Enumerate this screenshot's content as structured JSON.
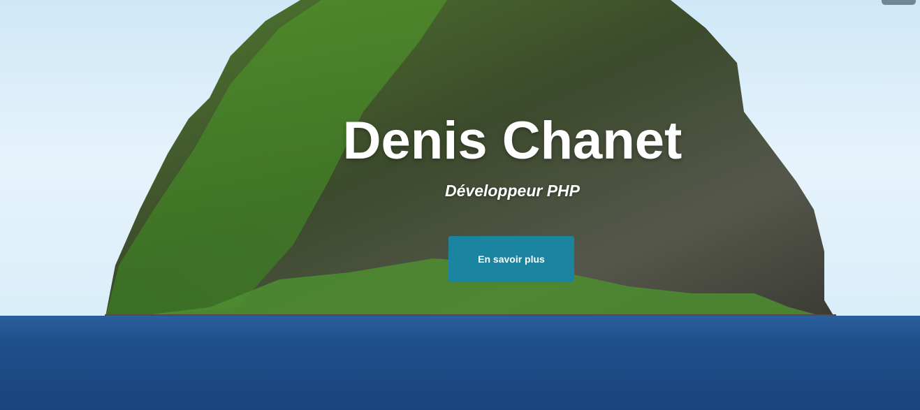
{
  "hero": {
    "title": "Denis Chanet",
    "subtitle": "Développeur PHP",
    "cta_label": "En savoir plus"
  },
  "colors": {
    "accent": "#1b84a0",
    "menu_tab": "#6f8898"
  }
}
